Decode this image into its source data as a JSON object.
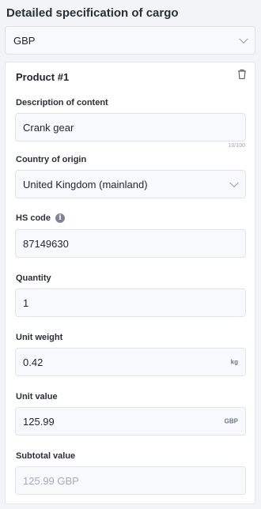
{
  "section": {
    "title": "Detailed specification of cargo",
    "currency": "GBP"
  },
  "product": {
    "title": "Product #1",
    "description": {
      "label": "Description of content",
      "value": "Crank gear",
      "counter": "10/100"
    },
    "origin": {
      "label": "Country of origin",
      "value": "United Kingdom (mainland)"
    },
    "hs_code": {
      "label": "HS code",
      "value": "87149630",
      "info_icon": "i"
    },
    "quantity": {
      "label": "Quantity",
      "value": "1"
    },
    "unit_weight": {
      "label": "Unit weight",
      "value": "0.42",
      "unit": "kg"
    },
    "unit_value": {
      "label": "Unit value",
      "value": "125.99",
      "unit": "GBP"
    },
    "subtotal": {
      "label": "Subtotal value",
      "value": "125.99 GBP"
    }
  },
  "icons": {
    "delete": "trash-icon",
    "dropdown": "chevron-down-icon",
    "info": "info-icon"
  }
}
